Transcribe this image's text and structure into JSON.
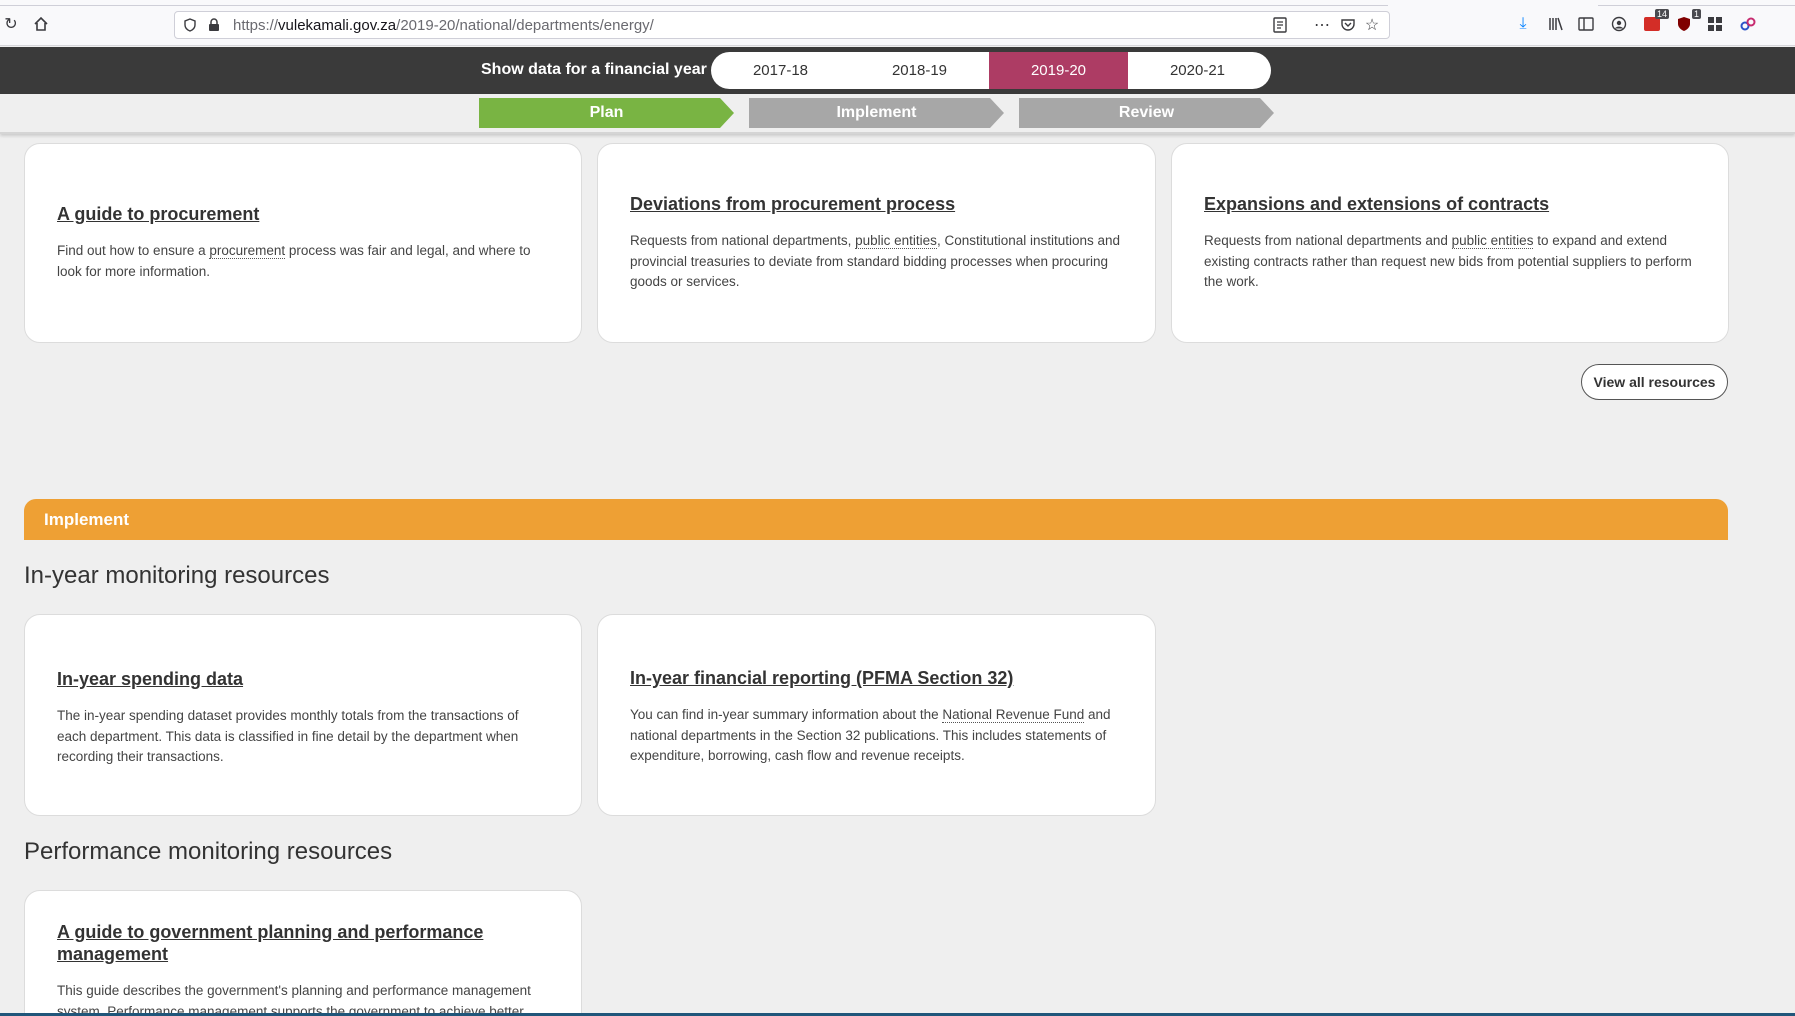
{
  "browser": {
    "url_prefix": "https://",
    "url_host": "vulekamali.gov.za",
    "url_path": "/2019-20/national/departments/energy/",
    "badge_addon1": "14",
    "badge_addon2": "1"
  },
  "year_bar": {
    "label": "Show data for a financial year",
    "years": [
      "2017-18",
      "2018-19",
      "2019-20",
      "2020-21"
    ],
    "active": "2019-20"
  },
  "stages": {
    "plan": "Plan",
    "implement": "Implement",
    "review": "Review"
  },
  "plan_resources": [
    {
      "title": "A guide to procurement",
      "desc_before": "Find out how to ensure a ",
      "desc_term": "procurement",
      "desc_after": " process was fair and legal, and where to look for more information."
    },
    {
      "title": "Deviations from procurement process",
      "desc_before": "Requests from national departments, ",
      "desc_term": "public entities",
      "desc_after": ", Constitutional institutions and provincial treasuries to deviate from standard bidding processes when procuring goods or services."
    },
    {
      "title": "Expansions and extensions of contracts",
      "desc_before": "Requests from national departments and ",
      "desc_term": "public entities",
      "desc_after": " to expand and extend existing contracts rather than request new bids from potential suppliers to perform the work."
    }
  ],
  "view_all_label": "View all resources",
  "implement_banner": "Implement",
  "in_year_heading": "In-year monitoring resources",
  "in_year_resources": [
    {
      "title": "In-year spending data",
      "desc": "The in-year spending dataset provides monthly totals from the transactions of each department. This data is classified in fine detail by the department when recording their transactions."
    },
    {
      "title": "In-year financial reporting (PFMA Section 32)",
      "desc_before": "You can find in-year summary information about the ",
      "desc_term": "National Revenue Fund",
      "desc_after": " and national departments in the Section 32 publications. This includes statements of expenditure, borrowing, cash flow and revenue receipts."
    }
  ],
  "performance_heading": "Performance monitoring resources",
  "performance_resources": [
    {
      "title": "A guide to government planning and performance management",
      "desc": "This guide describes the government's planning and performance management system. Performance management supports the government to achieve better"
    }
  ]
}
